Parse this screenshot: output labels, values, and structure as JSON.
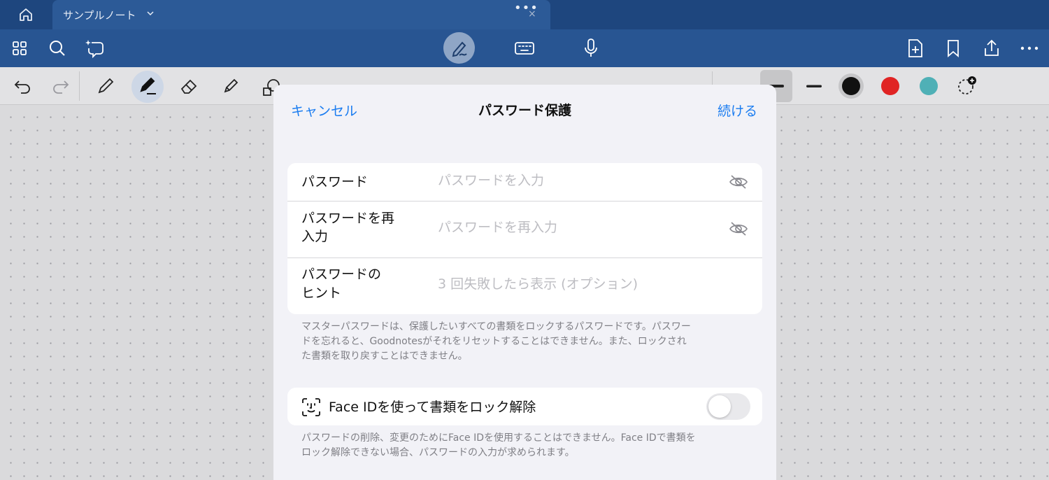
{
  "tabbar": {
    "tab_title": "サンプルノート",
    "tab_dots": "•••",
    "tab_close": "×"
  },
  "toolbar": {
    "left_icons": [
      "grid-icon",
      "search-icon",
      "lasso-ai-icon"
    ],
    "center_icons": [
      "pen-mode-icon",
      "keyboard-icon",
      "microphone-icon"
    ],
    "right_icons": [
      "add-page-icon",
      "bookmark-icon",
      "share-icon",
      "more-icon"
    ]
  },
  "tools": {
    "items": [
      "undo-icon",
      "redo-icon",
      "pencil-icon",
      "pen-icon",
      "eraser-icon",
      "highlighter-icon",
      "shape-icon",
      "lasso-icon"
    ],
    "colors": [
      "#111111",
      "#e02424",
      "#4fb0b6"
    ]
  },
  "modal": {
    "cancel": "キャンセル",
    "title": "パスワード保護",
    "continue": "続ける",
    "password_label": "パスワード",
    "password_placeholder": "パスワードを入力",
    "reenter_label_1": "パスワードを再",
    "reenter_label_2": "入力",
    "reenter_placeholder": "パスワードを再入力",
    "hint_label_1": "パスワードの",
    "hint_label_2": "ヒント",
    "hint_placeholder": "3 回失敗したら表示 (オプション)",
    "master_note_1": "マスターパスワードは、保護したいすべての書類をロックするパスワードです。パスワー",
    "master_note_2": "ドを忘れると、Goodnotesがそれをリセットすることはできません。また、ロックされ",
    "master_note_3": "た書類を取り戻すことはできません。",
    "faceid_label": "Face IDを使って書類をロック解除",
    "faceid_enabled": false,
    "faceid_note_1": "パスワードの削除、変更のためにFace IDを使用することはできません。Face IDで書類を",
    "faceid_note_2": "ロック解除できない場合、パスワードの入力が求められます。"
  }
}
